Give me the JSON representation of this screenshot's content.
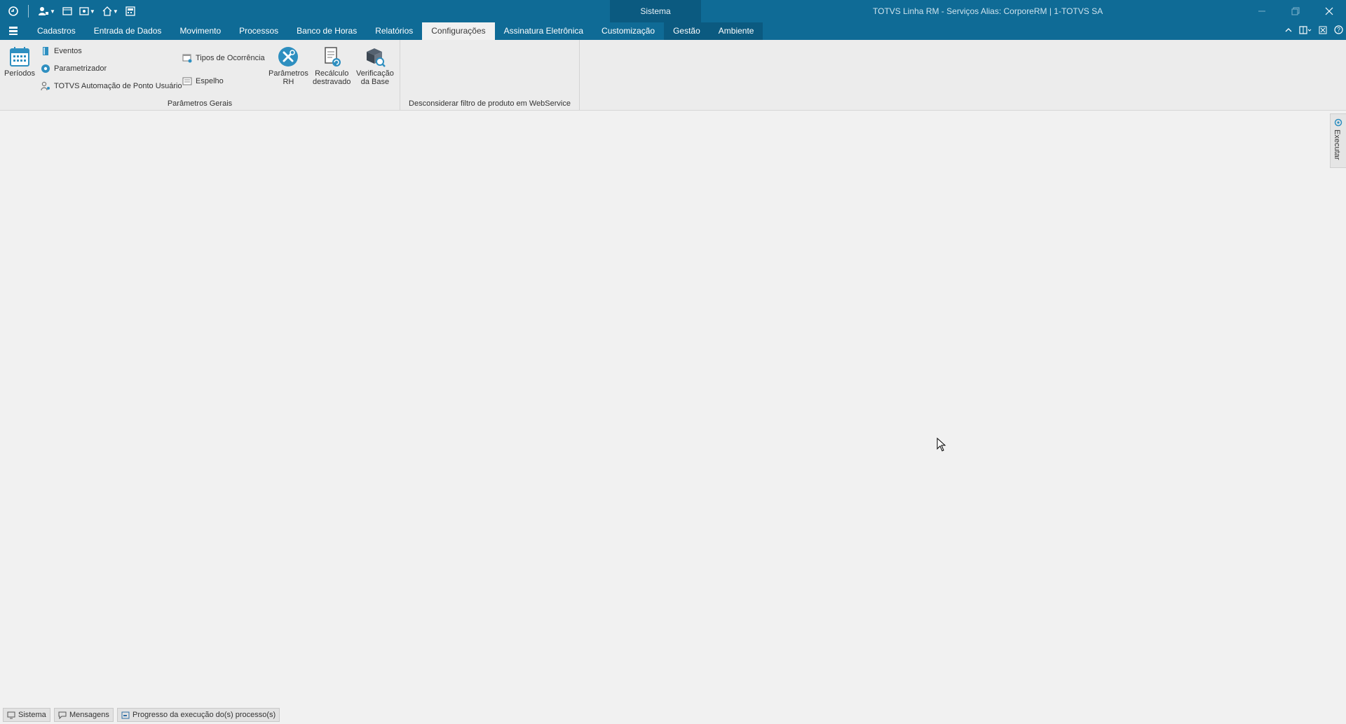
{
  "titlebar": {
    "context_tab": "Sistema",
    "window_title": "TOTVS Linha RM - Serviços  Alias: CorporeRM | 1-TOTVS SA"
  },
  "menu": {
    "tabs": [
      "Cadastros",
      "Entrada de Dados",
      "Movimento",
      "Processos",
      "Banco de Horas",
      "Relatórios",
      "Configurações",
      "Assinatura Eletrônica",
      "Customização",
      "Gestão",
      "Ambiente"
    ],
    "active_tab": "Configurações"
  },
  "ribbon": {
    "periodos": "Períodos",
    "eventos": "Eventos",
    "parametrizador": "Parametrizador",
    "automacao": "TOTVS Automação de Ponto Usuário",
    "tipos_ocorrencia": "Tipos de Ocorrência",
    "espelho": "Espelho",
    "parametros_rh_1": "Parâmetros",
    "parametros_rh_2": "RH",
    "recalculo_1": "Recálculo",
    "recalculo_2": "destravado",
    "verificacao_1": "Verificação",
    "verificacao_2": "da Base",
    "group_parametros_gerais": "Parâmetros Gerais",
    "group_webservice": "Desconsiderar filtro de produto em WebService"
  },
  "side_panel": {
    "label": "Executar"
  },
  "statusbar": {
    "sistema": "Sistema",
    "mensagens": "Mensagens",
    "progresso": "Progresso da execução do(s) processo(s)"
  },
  "colors": {
    "titlebar": "#0f6b96",
    "context": "#0b5a80",
    "accent_icon": "#2e8fc0"
  }
}
